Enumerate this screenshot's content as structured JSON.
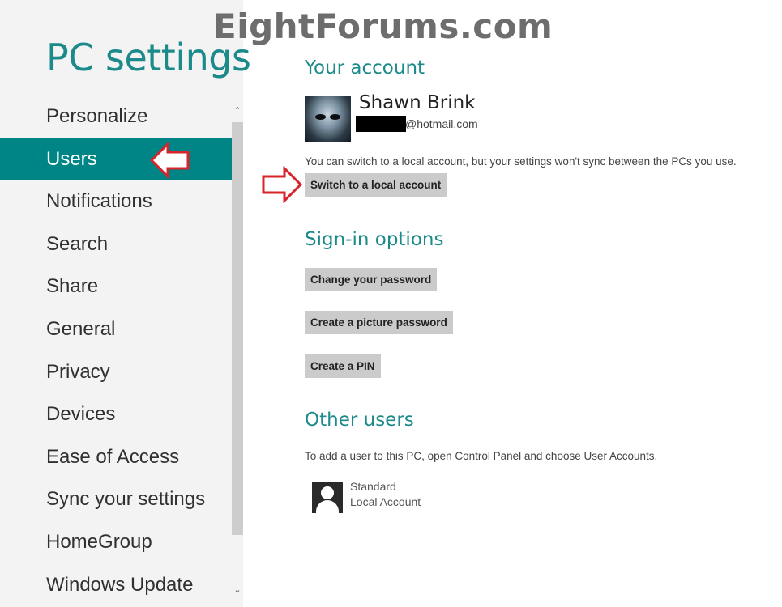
{
  "watermark": "EightForums.com",
  "sidebar": {
    "title": "PC settings",
    "items": [
      {
        "label": "Personalize"
      },
      {
        "label": "Users",
        "selected": true
      },
      {
        "label": "Notifications"
      },
      {
        "label": "Search"
      },
      {
        "label": "Share"
      },
      {
        "label": "General"
      },
      {
        "label": "Privacy"
      },
      {
        "label": "Devices"
      },
      {
        "label": "Ease of Access"
      },
      {
        "label": "Sync your settings"
      },
      {
        "label": "HomeGroup"
      },
      {
        "label": "Windows Update"
      }
    ]
  },
  "account": {
    "heading": "Your account",
    "name": "Shawn Brink",
    "email_suffix": "@hotmail.com",
    "switch_desc": "You can switch to a local account, but your settings won't sync between the PCs you use.",
    "switch_button": "Switch to a local account"
  },
  "signin": {
    "heading": "Sign-in options",
    "change_password": "Change your password",
    "picture_password": "Create a picture password",
    "pin": "Create a PIN"
  },
  "others": {
    "heading": "Other users",
    "desc": "To add a user to this PC, open Control Panel and choose User Accounts.",
    "user": {
      "type": "Standard",
      "kind": "Local Account"
    }
  },
  "colors": {
    "accent": "#008586",
    "annotation": "#d8232a"
  }
}
